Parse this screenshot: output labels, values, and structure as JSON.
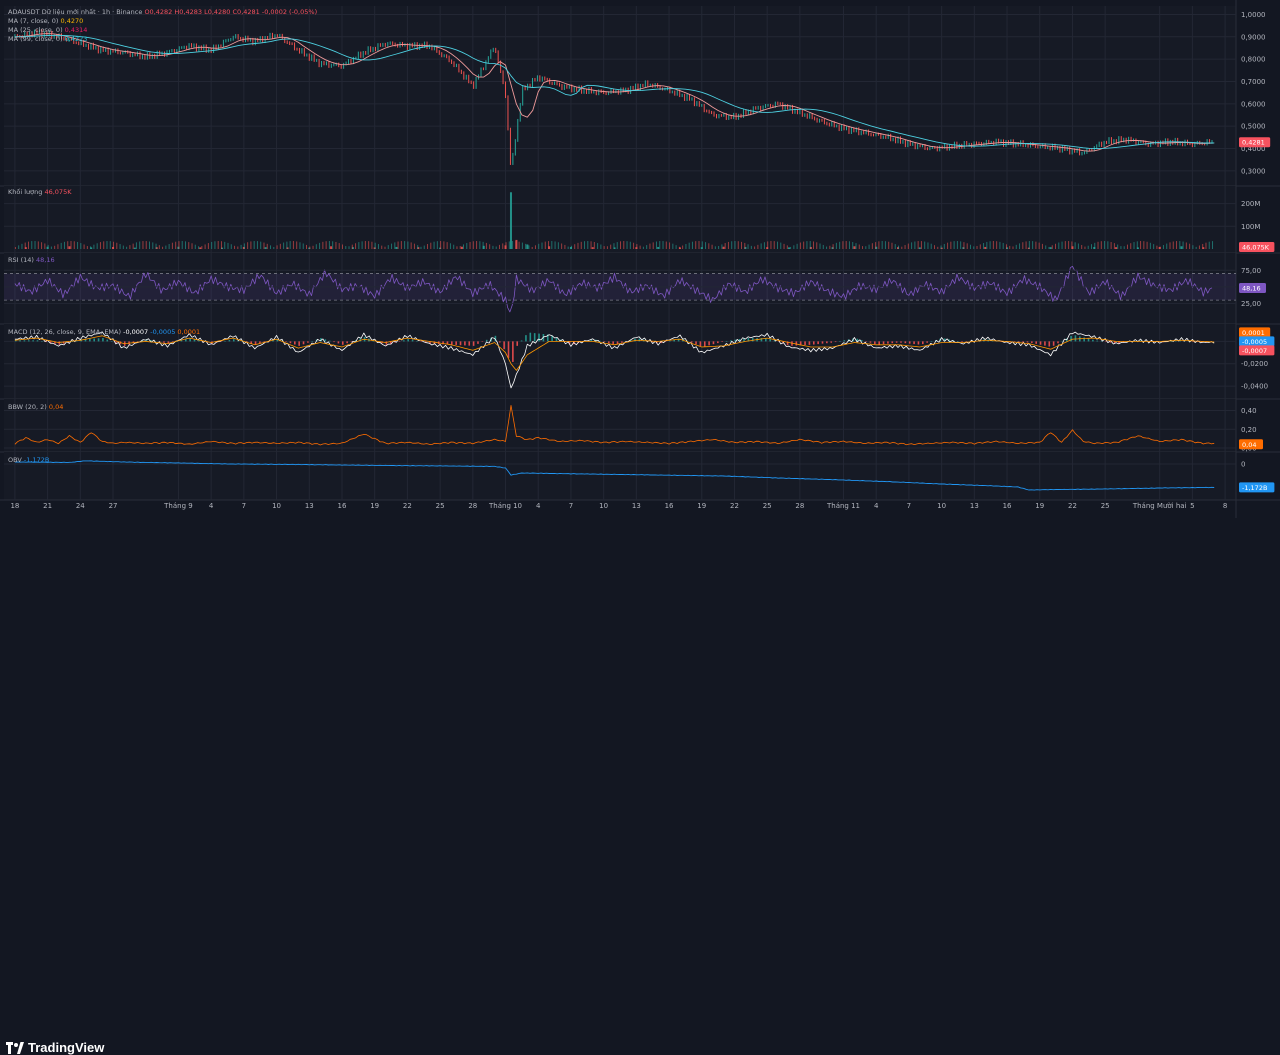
{
  "chart_data": [
    {
      "type": "line",
      "pane": "price",
      "legend_main": [
        {
          "text": "ADAUSDT Dữ liệu mới nhất · 1h · Binance",
          "color": "#b2b5be"
        },
        {
          "text": "O0,4282",
          "color": "#f7525f"
        },
        {
          "text": "H0,4283",
          "color": "#f7525f"
        },
        {
          "text": "L0,4280",
          "color": "#f7525f"
        },
        {
          "text": "C0,4281",
          "color": "#f7525f"
        },
        {
          "text": "-0,0002 (-0,05%)",
          "color": "#f7525f"
        }
      ],
      "indicators": [
        {
          "label": "MA (7, close, 0)",
          "value": "0,4270",
          "color": "#f7b500"
        },
        {
          "label": "MA (25, close, 0)",
          "value": "0,4314",
          "color": "#e91e63"
        },
        {
          "label": "MA (99, close, 0)",
          "value": "0,4223",
          "color": "#26c6da"
        }
      ],
      "y_ticks": [
        "1,0000",
        "0,9000",
        "0,8000",
        "0,7000",
        "0,6000",
        "0,5000",
        "0,4000",
        "0,3000"
      ],
      "ylim": [
        0.25,
        1.02
      ],
      "last_value_label": "0,4281",
      "last_value": 0.4281,
      "x": [
        0,
        4,
        8,
        12,
        16,
        20,
        24,
        28,
        32,
        36,
        40,
        44,
        48,
        52,
        56,
        60,
        64,
        68,
        72,
        76,
        80,
        84,
        88,
        90,
        91,
        93,
        96,
        100,
        104,
        108,
        112,
        116,
        120,
        124,
        128,
        132,
        136,
        140,
        144,
        148,
        152,
        156,
        160,
        164,
        168,
        172,
        176,
        180,
        184,
        188,
        192,
        196,
        200,
        204,
        208,
        212,
        216,
        220
      ],
      "values": [
        0.9,
        0.92,
        0.9,
        0.87,
        0.84,
        0.83,
        0.81,
        0.83,
        0.86,
        0.84,
        0.9,
        0.88,
        0.91,
        0.84,
        0.78,
        0.77,
        0.83,
        0.87,
        0.86,
        0.86,
        0.79,
        0.68,
        0.86,
        0.64,
        0.3,
        0.66,
        0.72,
        0.68,
        0.66,
        0.65,
        0.66,
        0.69,
        0.66,
        0.62,
        0.55,
        0.54,
        0.58,
        0.6,
        0.56,
        0.52,
        0.49,
        0.47,
        0.45,
        0.42,
        0.4,
        0.41,
        0.42,
        0.43,
        0.42,
        0.41,
        0.4,
        0.38,
        0.43,
        0.44,
        0.42,
        0.43,
        0.42,
        0.43
      ]
    },
    {
      "type": "bar",
      "pane": "volume",
      "legend_label": "Khối lượng",
      "legend_value": "46,075K",
      "y_ticks": [
        "200M",
        "100M"
      ],
      "ylim": [
        0,
        260
      ],
      "last_value_label": "46,075K",
      "x": [
        2,
        6,
        10,
        14,
        18,
        22,
        26,
        30,
        34,
        38,
        42,
        46,
        50,
        54,
        58,
        62,
        66,
        70,
        74,
        78,
        82,
        86,
        90,
        91,
        92,
        94,
        98,
        102,
        106,
        110,
        114,
        118,
        122,
        126,
        130,
        134,
        138,
        142,
        146,
        150,
        154,
        158,
        162,
        166,
        170,
        174,
        178,
        182,
        186,
        190,
        194,
        198,
        202,
        206,
        210,
        214,
        218
      ],
      "values": [
        8,
        10,
        12,
        7,
        9,
        6,
        8,
        10,
        7,
        6,
        9,
        8,
        7,
        6,
        12,
        8,
        7,
        9,
        8,
        6,
        10,
        14,
        16,
        250,
        40,
        20,
        12,
        9,
        8,
        7,
        8,
        9,
        7,
        8,
        10,
        9,
        8,
        7,
        9,
        8,
        12,
        10,
        8,
        7,
        6,
        8,
        9,
        7,
        6,
        8,
        12,
        9,
        8,
        7,
        9,
        12,
        8
      ]
    },
    {
      "type": "line",
      "pane": "rsi",
      "legend_label": "RSI (14)",
      "legend_value": "48,16",
      "y_ticks": [
        "75,00",
        "50,00",
        "25,00"
      ],
      "ylim": [
        0,
        95
      ],
      "bands": [
        30,
        70
      ],
      "last_value_label": "48,16",
      "x": [
        0,
        3,
        6,
        9,
        12,
        15,
        18,
        21,
        24,
        27,
        30,
        33,
        36,
        39,
        42,
        45,
        48,
        51,
        54,
        57,
        60,
        63,
        66,
        69,
        72,
        75,
        78,
        81,
        84,
        87,
        90,
        91,
        92,
        95,
        98,
        101,
        104,
        107,
        110,
        113,
        116,
        119,
        122,
        125,
        128,
        131,
        134,
        137,
        140,
        143,
        146,
        149,
        152,
        155,
        158,
        161,
        164,
        167,
        170,
        173,
        176,
        179,
        182,
        185,
        188,
        191,
        194,
        197,
        200,
        203,
        206,
        209,
        212,
        215,
        218,
        220
      ],
      "values": [
        55,
        42,
        60,
        38,
        65,
        48,
        52,
        35,
        70,
        44,
        58,
        40,
        62,
        50,
        45,
        68,
        40,
        55,
        38,
        72,
        46,
        52,
        36,
        64,
        48,
        58,
        42,
        66,
        40,
        54,
        30,
        8,
        62,
        44,
        60,
        38,
        56,
        48,
        65,
        42,
        52,
        36,
        60,
        45,
        30,
        55,
        42,
        62,
        48,
        40,
        58,
        44,
        35,
        52,
        46,
        60,
        38,
        54,
        42,
        65,
        48,
        56,
        40,
        62,
        50,
        30,
        82,
        40,
        58,
        35,
        66,
        52,
        45,
        60,
        42,
        48
      ]
    },
    {
      "type": "line",
      "pane": "macd",
      "legend_label": "MACD (12, 26, close, 9, EMA, EMA)",
      "legend_values": [
        {
          "text": "-0,0007",
          "color": "#ffffff"
        },
        {
          "text": "-0,0005",
          "color": "#2196f3"
        },
        {
          "text": "0,0001",
          "color": "#ff6d00"
        }
      ],
      "y_ticks": [
        "0,0000",
        "-0,0200",
        "-0,0400"
      ],
      "ylim": [
        -0.048,
        0.012
      ],
      "badges": [
        {
          "text": "0,0001",
          "value": 0.0001,
          "color": "#ff6d00"
        },
        {
          "text": "-0,0005",
          "value": -0.0005,
          "color": "#2196f3"
        },
        {
          "text": "-0,0007",
          "value": -0.0007,
          "color": "#f7525f"
        }
      ],
      "x": [
        0,
        4,
        8,
        12,
        16,
        20,
        24,
        28,
        32,
        36,
        40,
        44,
        48,
        52,
        56,
        60,
        64,
        68,
        72,
        76,
        80,
        84,
        88,
        90,
        91,
        92,
        94,
        98,
        102,
        106,
        110,
        114,
        118,
        122,
        126,
        130,
        134,
        138,
        142,
        146,
        150,
        154,
        158,
        162,
        166,
        170,
        174,
        178,
        182,
        186,
        190,
        194,
        198,
        202,
        206,
        210,
        214,
        218,
        220
      ],
      "macd": [
        0.002,
        0.004,
        -0.004,
        0.003,
        0.008,
        -0.006,
        0.002,
        -0.004,
        0.006,
        -0.003,
        0.005,
        -0.006,
        0.004,
        -0.01,
        0.002,
        -0.008,
        0.006,
        -0.004,
        0.005,
        -0.002,
        -0.006,
        -0.012,
        0.004,
        -0.02,
        -0.042,
        -0.03,
        -0.004,
        0.006,
        -0.003,
        0.002,
        -0.006,
        0.004,
        -0.002,
        0.005,
        -0.01,
        -0.004,
        0.003,
        0.006,
        -0.005,
        -0.008,
        -0.006,
        0.002,
        -0.006,
        -0.004,
        -0.008,
        0.002,
        -0.002,
        0.003,
        -0.001,
        -0.003,
        -0.012,
        0.008,
        0.004,
        -0.002,
        0.001,
        -0.001,
        0.002,
        -0.001,
        -0.0007
      ],
      "signal": [
        0.001,
        0.003,
        -0.001,
        0.001,
        0.005,
        -0.002,
        0.0,
        -0.002,
        0.003,
        -0.001,
        0.003,
        -0.003,
        0.002,
        -0.006,
        -0.001,
        -0.005,
        0.002,
        -0.001,
        0.003,
        0.0,
        -0.003,
        -0.008,
        -0.001,
        -0.01,
        -0.02,
        -0.026,
        -0.012,
        0.0,
        0.0,
        0.0,
        -0.003,
        0.001,
        0.0,
        0.002,
        -0.005,
        -0.004,
        0.0,
        0.003,
        -0.001,
        -0.005,
        -0.005,
        -0.001,
        -0.003,
        -0.003,
        -0.005,
        -0.001,
        -0.001,
        0.001,
        0.0,
        -0.002,
        -0.007,
        0.002,
        0.003,
        0.0,
        0.0,
        0.0,
        0.001,
        0.0,
        -0.0005
      ]
    },
    {
      "type": "line",
      "pane": "bbw",
      "legend_label": "BBW (20, 2)",
      "legend_value": "0,04",
      "y_ticks": [
        "0,40",
        "0,20",
        "0,00"
      ],
      "ylim": [
        0,
        0.48
      ],
      "last_value_label": "0,04",
      "x": [
        0,
        2,
        4,
        6,
        8,
        10,
        12,
        14,
        16,
        18,
        20,
        24,
        28,
        32,
        36,
        40,
        44,
        48,
        52,
        56,
        60,
        64,
        68,
        72,
        76,
        80,
        84,
        88,
        90,
        91,
        92,
        94,
        96,
        100,
        104,
        108,
        112,
        116,
        120,
        124,
        128,
        132,
        136,
        140,
        144,
        148,
        152,
        156,
        160,
        164,
        168,
        172,
        176,
        180,
        184,
        188,
        190,
        192,
        194,
        196,
        198,
        202,
        206,
        210,
        214,
        218,
        220
      ],
      "values": [
        0.04,
        0.1,
        0.05,
        0.08,
        0.04,
        0.12,
        0.05,
        0.16,
        0.06,
        0.04,
        0.05,
        0.04,
        0.05,
        0.03,
        0.06,
        0.04,
        0.05,
        0.04,
        0.05,
        0.03,
        0.04,
        0.14,
        0.04,
        0.05,
        0.03,
        0.05,
        0.04,
        0.08,
        0.06,
        0.44,
        0.12,
        0.08,
        0.1,
        0.06,
        0.07,
        0.05,
        0.06,
        0.05,
        0.04,
        0.06,
        0.08,
        0.05,
        0.06,
        0.04,
        0.08,
        0.05,
        0.06,
        0.04,
        0.05,
        0.03,
        0.04,
        0.05,
        0.04,
        0.06,
        0.04,
        0.05,
        0.16,
        0.05,
        0.18,
        0.06,
        0.04,
        0.05,
        0.12,
        0.06,
        0.08,
        0.04,
        0.04
      ]
    },
    {
      "type": "line",
      "pane": "obv",
      "legend_label": "OBV",
      "legend_value": "-1,172B",
      "y_ticks": [
        "0"
      ],
      "ylim": [
        -1.6,
        0.4
      ],
      "last_value_label": "-1,172B",
      "x": [
        0,
        10,
        13,
        20,
        30,
        40,
        50,
        60,
        70,
        80,
        88,
        90,
        91,
        93,
        100,
        110,
        120,
        130,
        140,
        150,
        160,
        170,
        180,
        184,
        186,
        190,
        200,
        210,
        220
      ],
      "values": [
        0.1,
        0.08,
        0.16,
        0.1,
        0.05,
        0.0,
        -0.02,
        -0.05,
        -0.08,
        -0.1,
        -0.12,
        -0.2,
        -0.55,
        -0.45,
        -0.48,
        -0.52,
        -0.56,
        -0.6,
        -0.7,
        -0.78,
        -0.88,
        -1.0,
        -1.1,
        -1.15,
        -1.3,
        -1.28,
        -1.25,
        -1.2,
        -1.17
      ]
    }
  ],
  "x_axis": {
    "ticks": [
      {
        "label": "18",
        "x": 0
      },
      {
        "label": "21",
        "x": 6
      },
      {
        "label": "24",
        "x": 12
      },
      {
        "label": "27",
        "x": 18
      },
      {
        "label": "Tháng 9",
        "x": 30
      },
      {
        "label": "4",
        "x": 36
      },
      {
        "label": "7",
        "x": 42
      },
      {
        "label": "10",
        "x": 48
      },
      {
        "label": "13",
        "x": 54
      },
      {
        "label": "16",
        "x": 60
      },
      {
        "label": "19",
        "x": 66
      },
      {
        "label": "22",
        "x": 72
      },
      {
        "label": "25",
        "x": 78
      },
      {
        "label": "28",
        "x": 84
      },
      {
        "label": "Tháng 10",
        "x": 90
      },
      {
        "label": "4",
        "x": 96
      },
      {
        "label": "7",
        "x": 102
      },
      {
        "label": "10",
        "x": 108
      },
      {
        "label": "13",
        "x": 114
      },
      {
        "label": "16",
        "x": 120
      },
      {
        "label": "19",
        "x": 126
      },
      {
        "label": "22",
        "x": 132
      },
      {
        "label": "25",
        "x": 138
      },
      {
        "label": "28",
        "x": 144
      },
      {
        "label": "Tháng 11",
        "x": 152
      },
      {
        "label": "4",
        "x": 158
      },
      {
        "label": "7",
        "x": 164
      },
      {
        "label": "10",
        "x": 170
      },
      {
        "label": "13",
        "x": 176
      },
      {
        "label": "16",
        "x": 182
      },
      {
        "label": "19",
        "x": 188
      },
      {
        "label": "22",
        "x": 194
      },
      {
        "label": "25",
        "x": 200
      },
      {
        "label": "Tháng Mười hai",
        "x": 210
      },
      {
        "label": "5",
        "x": 216
      },
      {
        "label": "8",
        "x": 222
      }
    ]
  },
  "footer": {
    "brand": "TradingView"
  },
  "colors": {
    "background": "#131722",
    "grid": "#232734",
    "up": "#26a69a",
    "down": "#ef5350",
    "rsi": "#7e57c2",
    "macd_line": "#ffffff",
    "signal": "#ff9800",
    "bbw": "#ff6d00",
    "obv": "#2196f3",
    "ma_fast": "#ef9a9a",
    "ma_slow": "#4dd0e1",
    "badge_red": "#f7525f"
  }
}
